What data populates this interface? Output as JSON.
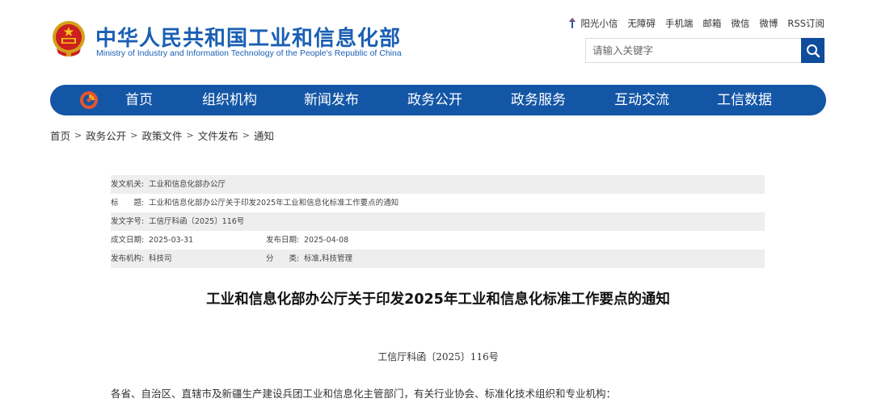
{
  "header": {
    "site_title": "中华人民共和国工业和信息化部",
    "site_subtitle": "Ministry of Industry and Information Technology of the People's Republic of China",
    "emblem_icon": "national-emblem-icon",
    "top_links": [
      "阳光小信",
      "无障碍",
      "手机端",
      "邮箱",
      "微信",
      "微博",
      "RSS订阅"
    ],
    "search": {
      "placeholder": "请输入关键字",
      "button_icon": "search-icon"
    },
    "colors": {
      "title": "#1a5fb4",
      "nav": "#1456a6",
      "search_button": "#0f4c9c"
    }
  },
  "nav": {
    "logo_icon": "ministry-logo-icon",
    "items": [
      "首页",
      "组织机构",
      "新闻发布",
      "政务公开",
      "政务服务",
      "互动交流",
      "工信数据"
    ]
  },
  "breadcrumb": [
    "首页",
    "政务公开",
    "政策文件",
    "文件发布",
    "通知"
  ],
  "info": {
    "issuer_label": "发文机关:",
    "issuer": "工业和信息化部办公厅",
    "title_label": "标　　题:",
    "title": "工业和信息化部办公厅关于印发2025年工业和信息化标准工作要点的通知",
    "docno_label": "发文字号:",
    "docno": "工信厅科函〔2025〕116号",
    "written_label": "成文日期:",
    "written": "2025-03-31",
    "published_label": "发布日期:",
    "published": "2025-04-08",
    "agency_label": "发布机构:",
    "agency": "科技司",
    "category_label": "分　　类:",
    "category": "标准,科技管理"
  },
  "article": {
    "title": "工业和信息化部办公厅关于印发2025年工业和信息化标准工作要点的通知",
    "number": "工信厅科函〔2025〕116号",
    "salutation": "各省、自治区、直辖市及新疆生产建设兵团工业和信息化主管部门，有关行业协会、标准化技术组织和专业机构："
  }
}
